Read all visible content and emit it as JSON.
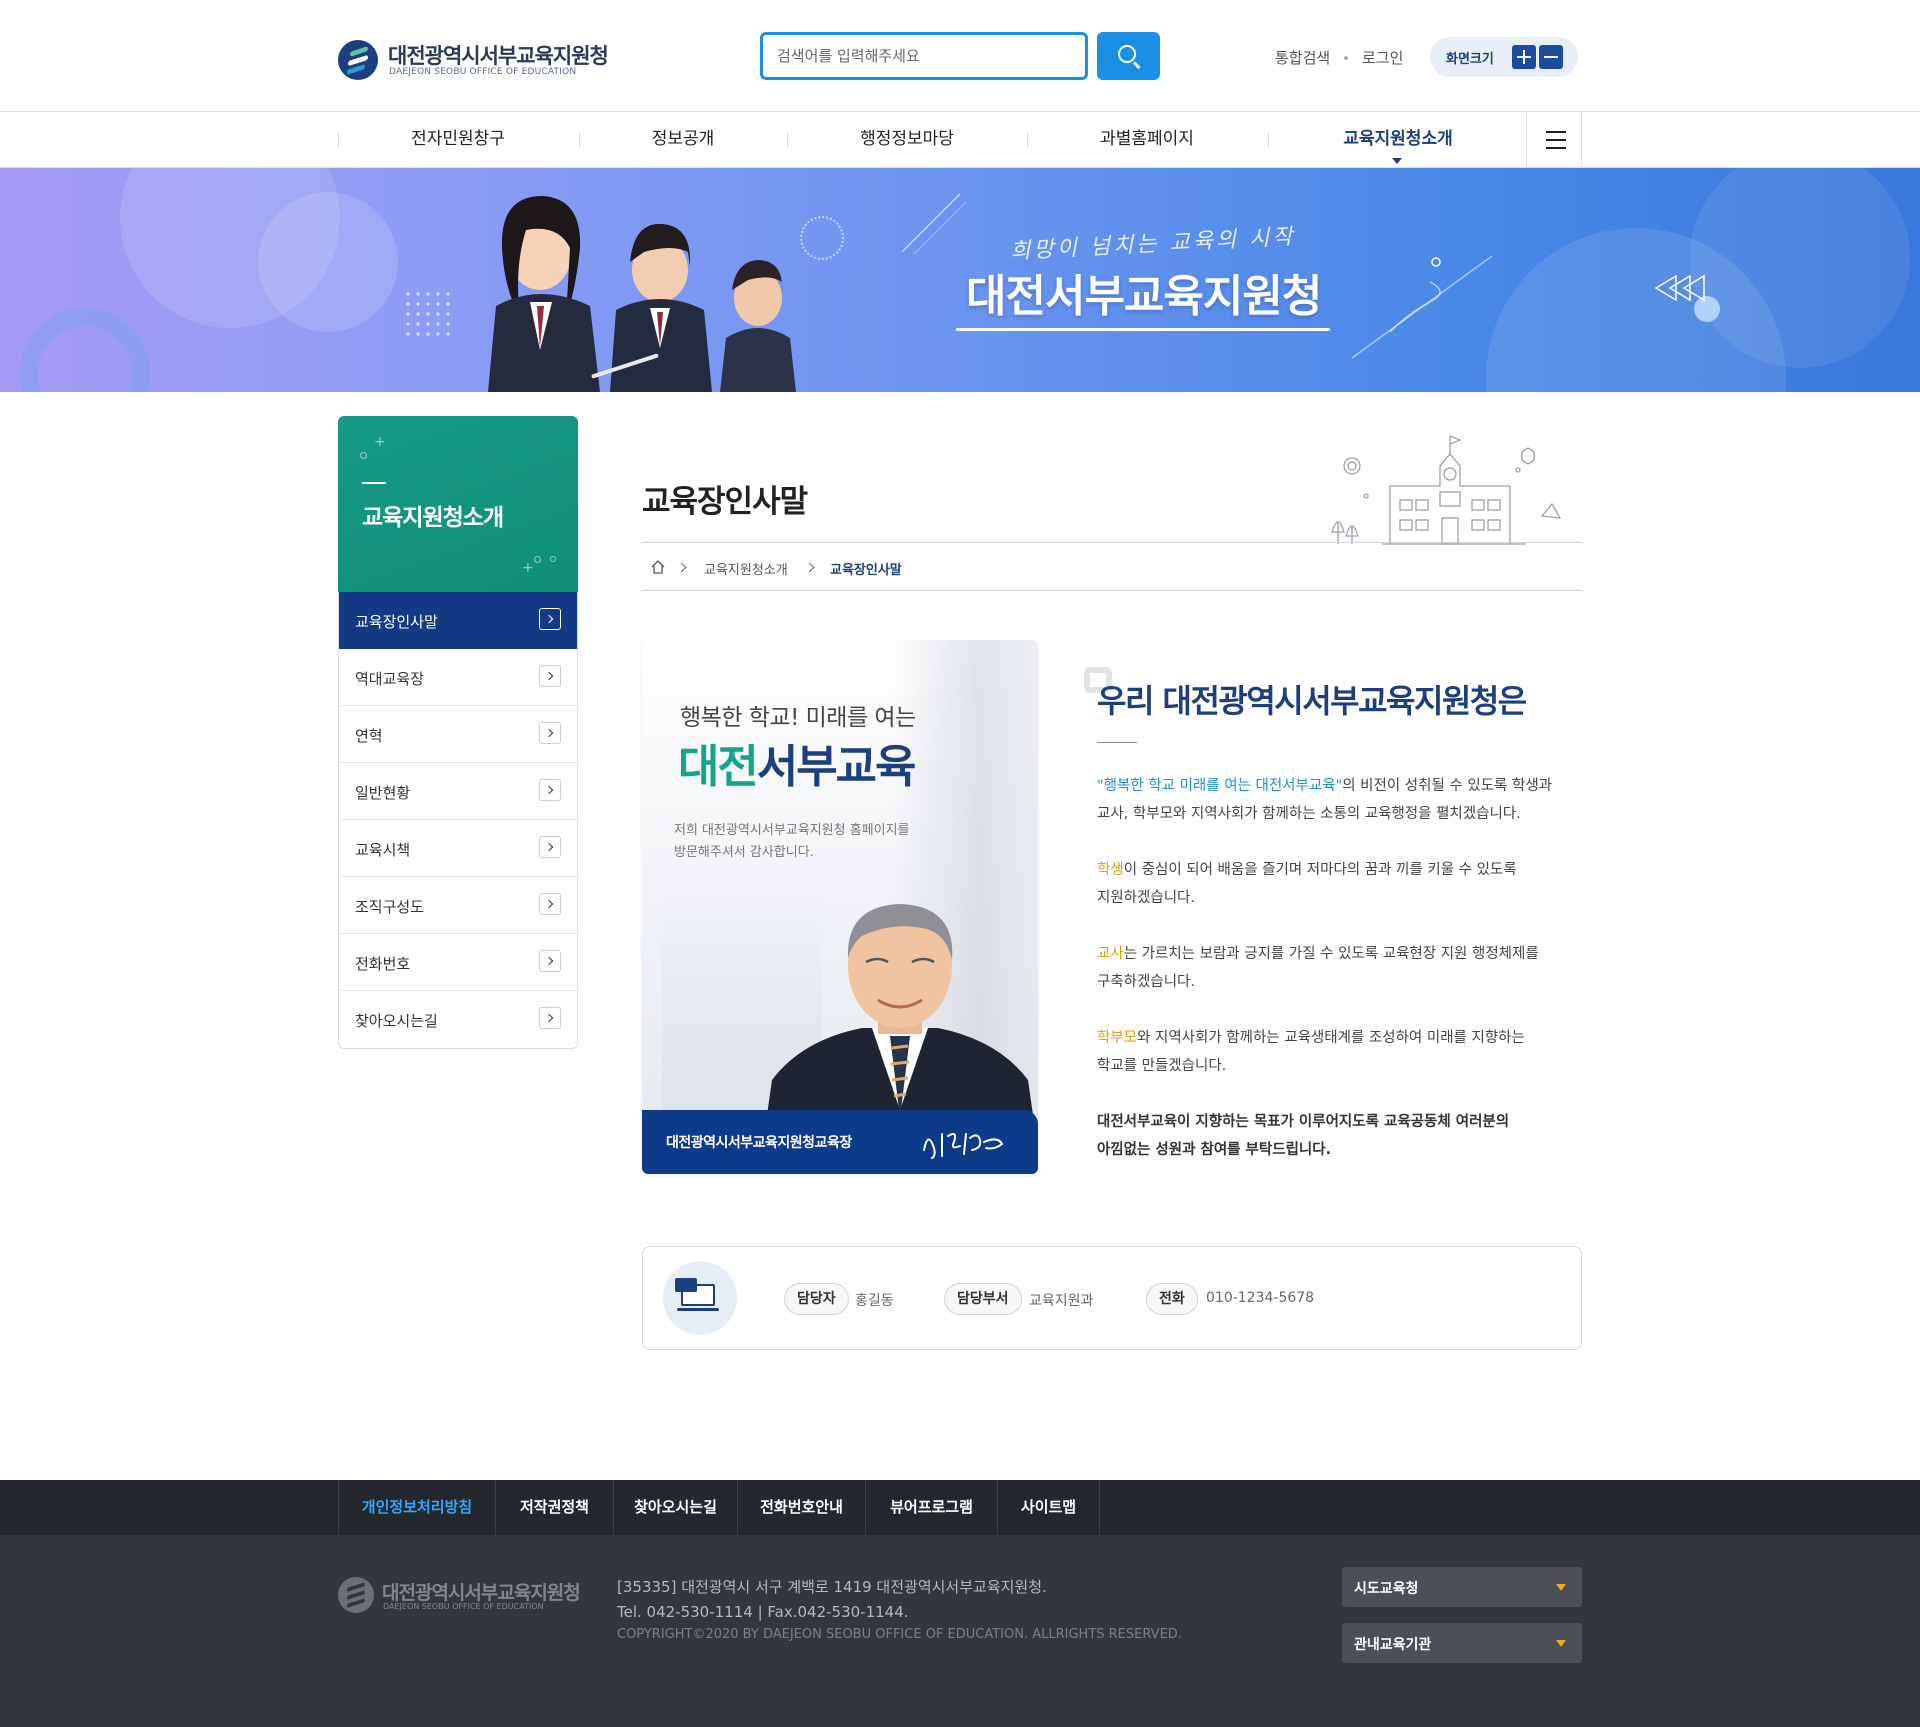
{
  "header": {
    "logo_name": "대전광역시서부교육지원청",
    "logo_en": "DAEJEON SEOBU OFFICE OF EDUCATION",
    "search_placeholder": "검색어를 입력해주세요",
    "util_links": [
      "통합검색",
      "로그인"
    ],
    "font_size_label": "화면크기"
  },
  "nav": {
    "items": [
      "전자민원창구",
      "정보공개",
      "행정정보마당",
      "과별홈페이지",
      "교육지원청소개"
    ],
    "active_index": 4
  },
  "banner": {
    "subtitle": "희망이 넘치는 교육의 시작",
    "title": "대전서부교육지원청"
  },
  "sidebar": {
    "title": "교육지원청소개",
    "items": [
      "교육장인사말",
      "역대교육장",
      "연혁",
      "일반현황",
      "교육시책",
      "조직구성도",
      "전화번호",
      "찾아오시는길"
    ],
    "active_index": 0
  },
  "page": {
    "title": "교육장인사말",
    "breadcrumb": [
      "교육지원청소개",
      "교육장인사말"
    ]
  },
  "greeting_card": {
    "subtitle": "행복한 학교! 미래를 여는",
    "title_part1": "대전",
    "title_part2": "서부교육",
    "desc_line1": "저희 대전광역시서부교육지원청 홈페이지를",
    "desc_line2": "방문해주셔서 감사합니다.",
    "footer_label": "대전광역시서부교육지원청교육장"
  },
  "greeting": {
    "heading": "우리 대전광역시서부교육지원청은",
    "p1_highlight": "\"행복한 학교 미래를 여는 대전서부교육\"",
    "p1_rest": "의 비전이 성취될 수 있도록 학생과",
    "p1_line2": "교사, 학부모와 지역사회가 함께하는 소통의 교육행정을 펼치겠습니다.",
    "p2_highlight": "학생",
    "p2_rest": "이 중심이 되어 배움을 즐기며 저마다의 꿈과 끼를 키울 수 있도록",
    "p2_line2": "지원하겠습니다.",
    "p3_highlight": "교사",
    "p3_rest": "는 가르치는 보람과 긍지를 가질 수 있도록 교육현장 지원 행정체제를",
    "p3_line2": "구축하겠습니다.",
    "p4_highlight": "학부모",
    "p4_rest": "와 지역사회가 함께하는 교육생태계를 조성하여 미래를 지향하는",
    "p4_line2": "학교를 만들겠습니다.",
    "p5_line1": "대전서부교육이 지향하는 목표가 이루어지도록 교육공동체 여러분의",
    "p5_line2": "아낌없는 성원과 참여를 부탁드립니다."
  },
  "contact": {
    "manager_label": "담당자",
    "manager_value": "홍길동",
    "dept_label": "담당부서",
    "dept_value": "교육지원과",
    "phone_label": "전화",
    "phone_value": "010-1234-5678"
  },
  "footer": {
    "links": [
      "개인정보처리방침",
      "저작권정책",
      "찾아오시는길",
      "전화번호안내",
      "뷰어프로그램",
      "사이트맵"
    ],
    "logo_name": "대전광역시서부교육지원청",
    "logo_en": "DAEJEON SEOBU OFFICE OF EDUCATION",
    "address": "[35335] 대전광역시 서구 계백로 1419 대전광역시서부교육지원청.",
    "tel_fax": "Tel. 042-530-1114 | Fax.042-530-1144.",
    "copyright": "COPYRIGHT©2020 BY DAEJEON SEOBU OFFICE OF EDUCATION. ALLRIGHTS RESERVED.",
    "select1": "시도교육청",
    "select2": "관내교육기관"
  },
  "colors": {
    "navy": "#1d3f7e",
    "accent_blue": "#1990e6",
    "green": "#169a86",
    "orange": "#f39800"
  }
}
